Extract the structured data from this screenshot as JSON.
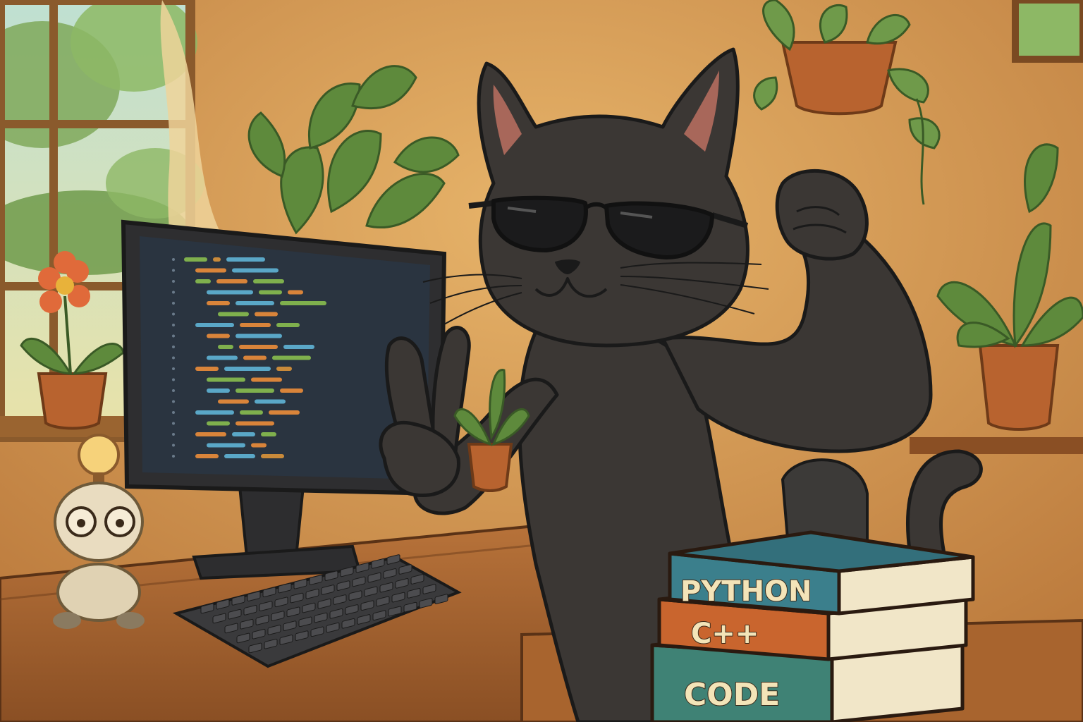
{
  "scene": {
    "books": [
      {
        "spine_label": "PYTHON",
        "color": "#3b7f8c"
      },
      {
        "spine_label": "C++",
        "color": "#c9652e"
      },
      {
        "spine_label": "CODE",
        "color": "#3f8275"
      }
    ]
  },
  "colors": {
    "wall": "#d49a55",
    "desk": "#a8642e",
    "cat_fur": "#3b3734",
    "monitor_screen": "#2a3440",
    "leaf": "#5e8a3c",
    "pot": "#b8632f"
  },
  "code_lines": [
    {
      "indent": 0,
      "segments": [
        {
          "w": 3,
          "c": "#7fb04d"
        },
        {
          "w": 1,
          "c": "#c98a3a"
        },
        {
          "w": 5,
          "c": "#5aa7c7"
        }
      ]
    },
    {
      "indent": 1,
      "segments": [
        {
          "w": 4,
          "c": "#d9843a"
        },
        {
          "w": 6,
          "c": "#5aa7c7"
        }
      ]
    },
    {
      "indent": 1,
      "segments": [
        {
          "w": 2,
          "c": "#7fb04d"
        },
        {
          "w": 4,
          "c": "#d9843a"
        },
        {
          "w": 4,
          "c": "#7fb04d"
        }
      ]
    },
    {
      "indent": 2,
      "segments": [
        {
          "w": 6,
          "c": "#5aa7c7"
        },
        {
          "w": 3,
          "c": "#7fb04d"
        },
        {
          "w": 2,
          "c": "#d9843a"
        }
      ]
    },
    {
      "indent": 2,
      "segments": [
        {
          "w": 3,
          "c": "#d9843a"
        },
        {
          "w": 5,
          "c": "#5aa7c7"
        },
        {
          "w": 6,
          "c": "#7fb04d"
        }
      ]
    },
    {
      "indent": 3,
      "segments": [
        {
          "w": 4,
          "c": "#7fb04d"
        },
        {
          "w": 3,
          "c": "#d9843a"
        }
      ]
    },
    {
      "indent": 1,
      "segments": [
        {
          "w": 5,
          "c": "#5aa7c7"
        },
        {
          "w": 4,
          "c": "#d9843a"
        },
        {
          "w": 3,
          "c": "#7fb04d"
        }
      ]
    },
    {
      "indent": 2,
      "segments": [
        {
          "w": 3,
          "c": "#d9843a"
        },
        {
          "w": 6,
          "c": "#5aa7c7"
        }
      ]
    },
    {
      "indent": 3,
      "segments": [
        {
          "w": 2,
          "c": "#7fb04d"
        },
        {
          "w": 5,
          "c": "#d9843a"
        },
        {
          "w": 4,
          "c": "#5aa7c7"
        }
      ]
    },
    {
      "indent": 2,
      "segments": [
        {
          "w": 4,
          "c": "#5aa7c7"
        },
        {
          "w": 3,
          "c": "#d9843a"
        },
        {
          "w": 5,
          "c": "#7fb04d"
        }
      ]
    },
    {
      "indent": 1,
      "segments": [
        {
          "w": 3,
          "c": "#d9843a"
        },
        {
          "w": 6,
          "c": "#5aa7c7"
        },
        {
          "w": 2,
          "c": "#c98a3a"
        }
      ]
    },
    {
      "indent": 2,
      "segments": [
        {
          "w": 5,
          "c": "#7fb04d"
        },
        {
          "w": 4,
          "c": "#d9843a"
        }
      ]
    },
    {
      "indent": 2,
      "segments": [
        {
          "w": 3,
          "c": "#5aa7c7"
        },
        {
          "w": 5,
          "c": "#7fb04d"
        },
        {
          "w": 3,
          "c": "#d9843a"
        }
      ]
    },
    {
      "indent": 3,
      "segments": [
        {
          "w": 4,
          "c": "#d9843a"
        },
        {
          "w": 4,
          "c": "#5aa7c7"
        }
      ]
    },
    {
      "indent": 1,
      "segments": [
        {
          "w": 5,
          "c": "#5aa7c7"
        },
        {
          "w": 3,
          "c": "#7fb04d"
        },
        {
          "w": 4,
          "c": "#d9843a"
        }
      ]
    },
    {
      "indent": 2,
      "segments": [
        {
          "w": 3,
          "c": "#7fb04d"
        },
        {
          "w": 5,
          "c": "#d9843a"
        }
      ]
    },
    {
      "indent": 1,
      "segments": [
        {
          "w": 4,
          "c": "#d9843a"
        },
        {
          "w": 3,
          "c": "#5aa7c7"
        },
        {
          "w": 2,
          "c": "#7fb04d"
        }
      ]
    },
    {
      "indent": 2,
      "segments": [
        {
          "w": 5,
          "c": "#5aa7c7"
        },
        {
          "w": 2,
          "c": "#d9843a"
        }
      ]
    },
    {
      "indent": 1,
      "segments": [
        {
          "w": 3,
          "c": "#d9843a"
        },
        {
          "w": 4,
          "c": "#5aa7c7"
        },
        {
          "w": 3,
          "c": "#c98a3a"
        }
      ]
    }
  ]
}
